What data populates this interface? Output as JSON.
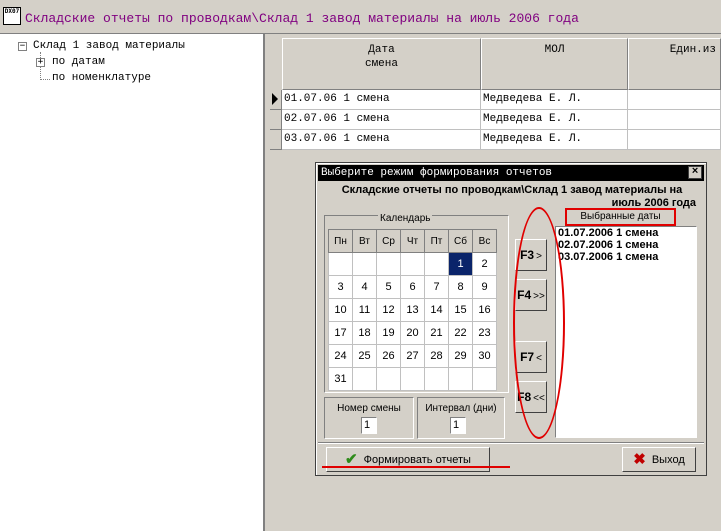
{
  "window": {
    "app_icon": "DX07",
    "title": "Складские отчеты по проводкам\\Склад 1 завод материалы на июль 2006 года"
  },
  "tree": {
    "root": "Склад 1 завод материалы",
    "items": [
      "по датам",
      "по номенклатуре"
    ]
  },
  "grid": {
    "headers": [
      {
        "line1": "Дата",
        "line2": "смена"
      },
      {
        "line1": "МОЛ",
        "line2": ""
      },
      {
        "line1": "Един.из",
        "line2": ""
      }
    ],
    "rows": [
      {
        "date": "01.07.06 1 смена",
        "mol": "Медведева Е. Л.",
        "unit": ""
      },
      {
        "date": "02.07.06 1 смена",
        "mol": "Медведева Е. Л.",
        "unit": ""
      },
      {
        "date": "03.07.06 1 смена",
        "mol": "Медведева Е. Л.",
        "unit": ""
      }
    ]
  },
  "dialog": {
    "title": "Выберите режим формирования отчетов",
    "close": "×",
    "heading_line1": "Складские отчеты по проводкам\\Склад 1 завод материалы на",
    "heading_line2": "июль 2006 года",
    "calendar": {
      "label": "Календарь",
      "weekdays": [
        "Пн",
        "Вт",
        "Ср",
        "Чт",
        "Пт",
        "Сб",
        "Вс"
      ],
      "weeks": [
        [
          "",
          "",
          "",
          "",
          "",
          "1",
          "2"
        ],
        [
          "3",
          "4",
          "5",
          "6",
          "7",
          "8",
          "9"
        ],
        [
          "10",
          "11",
          "12",
          "13",
          "14",
          "15",
          "16"
        ],
        [
          "17",
          "18",
          "19",
          "20",
          "21",
          "22",
          "23"
        ],
        [
          "24",
          "25",
          "26",
          "27",
          "28",
          "29",
          "30"
        ],
        [
          "31",
          "",
          "",
          "",
          "",
          "",
          ""
        ]
      ],
      "selected_day": "1"
    },
    "shift_number": {
      "label": "Номер смены",
      "value": "1"
    },
    "interval_days": {
      "label": "Интервал (дни)",
      "value": "1"
    },
    "buttons": {
      "f3": {
        "key": "F3",
        "arrow": ">"
      },
      "f4": {
        "key": "F4",
        "arrow": ">>"
      },
      "f7": {
        "key": "F7",
        "arrow": "<"
      },
      "f8": {
        "key": "F8",
        "arrow": "<<"
      }
    },
    "selected_dates": {
      "title": "Выбранные даты",
      "items": [
        "01.07.2006 1 смена",
        "02.07.2006 1 смена",
        "03.07.2006 1 смена"
      ]
    },
    "generate_label": "Формировать отчеты",
    "exit_label": "Выход"
  },
  "colors": {
    "title_text": "#800080",
    "annotation_red": "#e00000",
    "selection": "#0a246a",
    "check_green": "#2e8b1a"
  }
}
